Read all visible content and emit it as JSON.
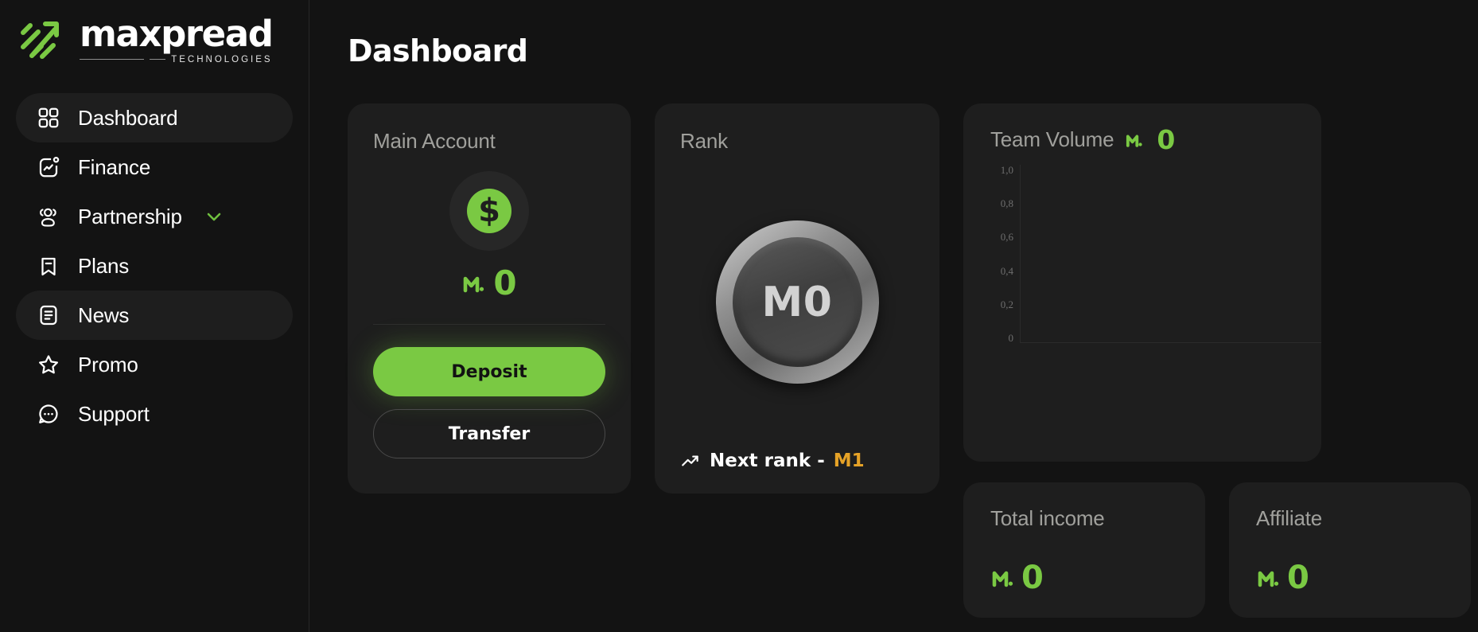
{
  "brand": {
    "name": "maxpread",
    "tagline": "TECHNOLOGIES",
    "logo_icon": "diagonal-stripes-arrow-logo",
    "accent_color": "#7ac943"
  },
  "sidebar": {
    "items": [
      {
        "label": "Dashboard",
        "icon": "grid-icon",
        "active": true
      },
      {
        "label": "Finance",
        "icon": "chart-box-icon",
        "active": false
      },
      {
        "label": "Partnership",
        "icon": "users-icon",
        "active": false,
        "expandable": true,
        "chevron": "chevron-down-icon"
      },
      {
        "label": "Plans",
        "icon": "bookmark-minus-icon",
        "active": false
      },
      {
        "label": "News",
        "icon": "document-lines-icon",
        "active": true
      },
      {
        "label": "Promo",
        "icon": "star-icon",
        "active": false
      },
      {
        "label": "Support",
        "icon": "chat-dots-icon",
        "active": false
      }
    ]
  },
  "header": {
    "title": "Dashboard"
  },
  "main_account": {
    "title": "Main Account",
    "coin_icon": "dollar-coin-icon",
    "currency_symbol": "M.",
    "balance": "0",
    "deposit_label": "Deposit",
    "transfer_label": "Transfer"
  },
  "rank": {
    "title": "Rank",
    "current": "M0",
    "next_prefix": "Next rank - ",
    "next_value": "M1",
    "next_icon": "trending-up-icon",
    "next_color": "#e5a227"
  },
  "team_volume": {
    "title": "Team Volume",
    "currency_symbol": "M.",
    "value": "0"
  },
  "chart_data": {
    "type": "line",
    "title": "Team Volume",
    "xlabel": "",
    "ylabel": "",
    "ylim": [
      0,
      1.0
    ],
    "ytick_labels": [
      "1,0",
      "0,8",
      "0,6",
      "0,4",
      "0,2",
      "0"
    ],
    "ytick_values": [
      1.0,
      0.8,
      0.6,
      0.4,
      0.2,
      0
    ],
    "x": [],
    "values": [],
    "grid": false,
    "legend": false
  },
  "stats": [
    {
      "label": "Total income",
      "currency_symbol": "M.",
      "value": "0"
    },
    {
      "label": "Affiliate",
      "currency_symbol": "M.",
      "value": "0"
    }
  ]
}
